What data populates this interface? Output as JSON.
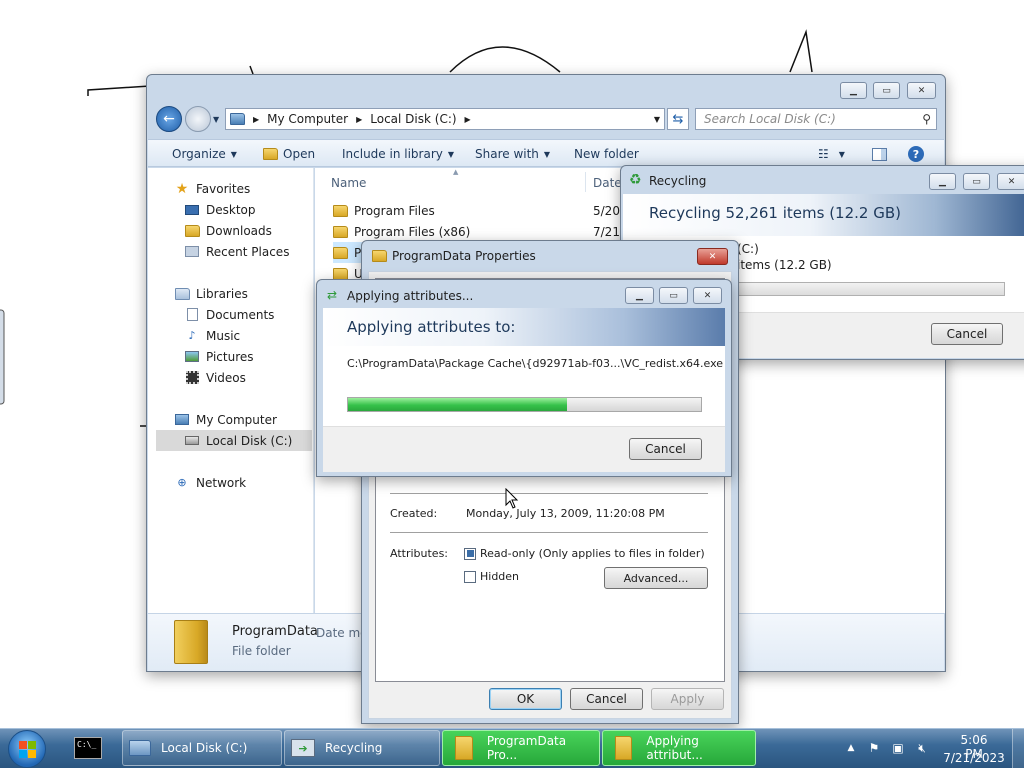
{
  "explorer": {
    "address": [
      "My Computer",
      "Local Disk (C:)"
    ],
    "search_placeholder": "Search Local Disk (C:)",
    "toolbar": {
      "organize": "Organize",
      "open": "Open",
      "include": "Include in library",
      "share": "Share with",
      "new_folder": "New folder"
    },
    "nav": {
      "favorites": "Favorites",
      "desktop": "Desktop",
      "downloads": "Downloads",
      "recent": "Recent Places",
      "libraries": "Libraries",
      "documents": "Documents",
      "music": "Music",
      "pictures": "Pictures",
      "videos": "Videos",
      "computer": "My Computer",
      "local_disk": "Local Disk (C:)",
      "network": "Network"
    },
    "columns": {
      "name": "Name",
      "date": "Date"
    },
    "files": [
      {
        "name": "Program Files",
        "date": "5/20/"
      },
      {
        "name": "Program Files (x86)",
        "date": "7/21/"
      },
      {
        "name": "Pr",
        "date": ""
      },
      {
        "name": "U",
        "date": ""
      }
    ],
    "details": {
      "name": "ProgramData",
      "date_label": "Date mo",
      "type": "File folder"
    }
  },
  "recycling": {
    "title": "Recycling",
    "header": "Recycling 52,261 items (12.2 GB)",
    "line1": "(C:)",
    "line2": "items (12.2 GB)",
    "cancel": "Cancel",
    "progress_pct": 0
  },
  "properties": {
    "title": "ProgramData Properties",
    "created_label": "Created:",
    "created_value": "Monday, July 13, 2009, 11:20:08 PM",
    "attributes_label": "Attributes:",
    "readonly": "Read-only (Only applies to files in folder)",
    "hidden": "Hidden",
    "advanced": "Advanced...",
    "ok": "OK",
    "cancel": "Cancel",
    "apply": "Apply"
  },
  "applying": {
    "title": "Applying attributes...",
    "header": "Applying attributes to:",
    "path": "C:\\ProgramData\\Package Cache\\{d92971ab-f03...\\VC_redist.x64.exe",
    "progress_pct": 62,
    "cancel": "Cancel"
  },
  "taskbar": {
    "items": [
      {
        "label": "Local Disk (C:)"
      },
      {
        "label": "Recycling"
      },
      {
        "label": "ProgramData Pro..."
      },
      {
        "label": "Applying attribut..."
      }
    ],
    "time": "5:06 PM",
    "date": "7/21/2023"
  },
  "colors": {
    "progress": "#36c24a",
    "taskbar": "#3b6a98",
    "accent": "#1e395b"
  }
}
